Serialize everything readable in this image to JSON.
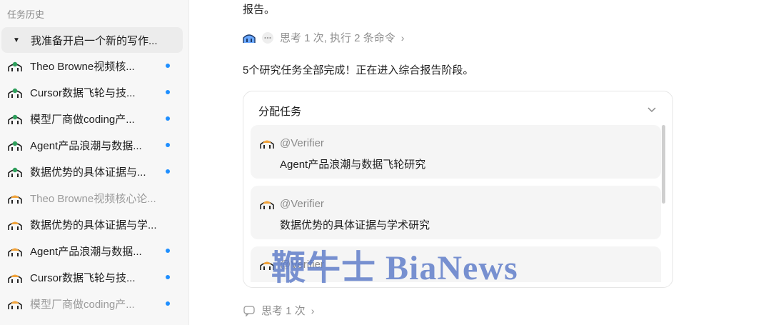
{
  "sidebar": {
    "title": "任务历史",
    "items": [
      {
        "label": "我准备开启一个新的写作...",
        "active": true,
        "muted": false,
        "dot": false,
        "icon": "caret-down-icon"
      },
      {
        "label": "Theo Browne视频核...",
        "active": false,
        "muted": false,
        "dot": true,
        "icon": "agent-green-icon"
      },
      {
        "label": "Cursor数据飞轮与技...",
        "active": false,
        "muted": false,
        "dot": true,
        "icon": "agent-green-icon"
      },
      {
        "label": "模型厂商做coding产...",
        "active": false,
        "muted": false,
        "dot": true,
        "icon": "agent-green-icon"
      },
      {
        "label": "Agent产品浪潮与数据...",
        "active": false,
        "muted": false,
        "dot": true,
        "icon": "agent-green-icon"
      },
      {
        "label": "数据优势的具体证据与...",
        "active": false,
        "muted": false,
        "dot": true,
        "icon": "agent-green-icon"
      },
      {
        "label": "Theo Browne视频核心论...",
        "active": false,
        "muted": true,
        "dot": false,
        "icon": "agent-orange-icon"
      },
      {
        "label": "数据优势的具体证据与学...",
        "active": false,
        "muted": false,
        "dot": false,
        "icon": "agent-orange-icon"
      },
      {
        "label": "Agent产品浪潮与数据...",
        "active": false,
        "muted": false,
        "dot": true,
        "icon": "agent-orange-icon"
      },
      {
        "label": "Cursor数据飞轮与技...",
        "active": false,
        "muted": false,
        "dot": true,
        "icon": "agent-orange-icon"
      },
      {
        "label": "模型厂商做coding产...",
        "active": false,
        "muted": true,
        "dot": true,
        "icon": "agent-orange-icon"
      }
    ]
  },
  "main": {
    "report_text": "报告。",
    "think_top": "思考 1 次, 执行 2 条命令",
    "status": "5个研究任务全部完成！正在进入综合报告阶段。",
    "card": {
      "title": "分配任务",
      "subtasks": [
        {
          "agent": "@Verifier",
          "desc": "Agent产品浪潮与数据飞轮研究"
        },
        {
          "agent": "@Verifier",
          "desc": "数据优势的具体证据与学术研究"
        },
        {
          "agent": "@Verifier",
          "desc": ""
        }
      ]
    },
    "think_bottom": "思考 1 次"
  },
  "watermark": "鞭牛士 BiaNews",
  "colors": {
    "accent_dot": "#1f8fff",
    "agent_green": "#2e9e5b",
    "agent_orange": "#f2a33a",
    "sidebar_bg": "#f7f7f7"
  }
}
